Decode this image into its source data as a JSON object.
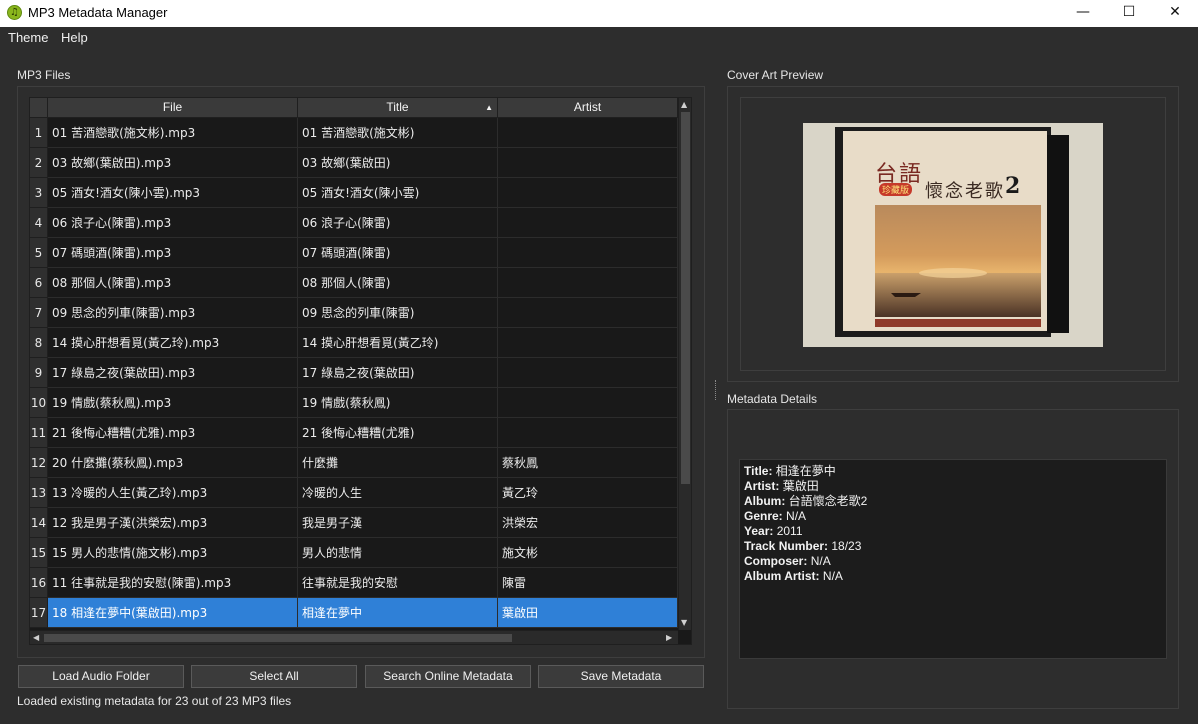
{
  "window": {
    "title": "MP3 Metadata Manager",
    "controls": {
      "minimize": "—",
      "maximize": "☐",
      "close": "✕"
    }
  },
  "menu": {
    "items": [
      "Theme",
      "Help"
    ]
  },
  "files_panel": {
    "label": "MP3 Files",
    "columns": [
      "File",
      "Title",
      "Artist"
    ],
    "sort_column": "Title",
    "rows": [
      {
        "n": "1",
        "file": "01 苦酒戀歌(施文彬).mp3",
        "title": "01 苦酒戀歌(施文彬)",
        "artist": ""
      },
      {
        "n": "2",
        "file": "03 故鄉(葉啟田).mp3",
        "title": "03 故鄉(葉啟田)",
        "artist": ""
      },
      {
        "n": "3",
        "file": "05 酒女!酒女(陳小雲).mp3",
        "title": "05 酒女!酒女(陳小雲)",
        "artist": ""
      },
      {
        "n": "4",
        "file": "06 浪子心(陳雷).mp3",
        "title": "06 浪子心(陳雷)",
        "artist": ""
      },
      {
        "n": "5",
        "file": "07 碼頭酒(陳雷).mp3",
        "title": "07 碼頭酒(陳雷)",
        "artist": ""
      },
      {
        "n": "6",
        "file": "08 那個人(陳雷).mp3",
        "title": "08 那個人(陳雷)",
        "artist": ""
      },
      {
        "n": "7",
        "file": "09 思念的列車(陳雷).mp3",
        "title": "09 思念的列車(陳雷)",
        "artist": ""
      },
      {
        "n": "8",
        "file": "14 摸心肝想看覓(黃乙玲).mp3",
        "title": "14 摸心肝想看覓(黃乙玲)",
        "artist": ""
      },
      {
        "n": "9",
        "file": "17 綠島之夜(葉啟田).mp3",
        "title": "17 綠島之夜(葉啟田)",
        "artist": ""
      },
      {
        "n": "10",
        "file": "19 情戲(蔡秋鳳).mp3",
        "title": "19 情戲(蔡秋鳳)",
        "artist": ""
      },
      {
        "n": "11",
        "file": "21 後悔心糟糟(尤雅).mp3",
        "title": "21 後悔心糟糟(尤雅)",
        "artist": ""
      },
      {
        "n": "12",
        "file": "20 什麼攤(蔡秋鳳).mp3",
        "title": "什麼攤",
        "artist": "蔡秋鳳"
      },
      {
        "n": "13",
        "file": "13 冷暖的人生(黃乙玲).mp3",
        "title": "冷暖的人生",
        "artist": "黃乙玲"
      },
      {
        "n": "14",
        "file": "12 我是男子漢(洪榮宏).mp3",
        "title": "我是男子漢",
        "artist": "洪榮宏"
      },
      {
        "n": "15",
        "file": "15 男人的悲情(施文彬).mp3",
        "title": "男人的悲情",
        "artist": "施文彬"
      },
      {
        "n": "16",
        "file": "11 往事就是我的安慰(陳雷).mp3",
        "title": "往事就是我的安慰",
        "artist": "陳雷"
      },
      {
        "n": "17",
        "file": "18 相逢在夢中(葉啟田).mp3",
        "title": "相逢在夢中",
        "artist": "葉啟田",
        "selected": true
      }
    ]
  },
  "buttons": {
    "load": "Load Audio Folder",
    "select_all": "Select All",
    "search": "Search Online Metadata",
    "save": "Save Metadata"
  },
  "status": "Loaded existing metadata for 23 out of 23 MP3 files",
  "cover_panel": {
    "label": "Cover Art Preview",
    "cover_title_1": "台語",
    "cover_title_2": "懷念老歌",
    "cover_number": "2",
    "cover_tag": "珍藏版"
  },
  "metadata_panel": {
    "label": "Metadata Details",
    "fields": [
      {
        "key": "Title:",
        "value": "相逢在夢中"
      },
      {
        "key": "Artist:",
        "value": "葉啟田"
      },
      {
        "key": "Album:",
        "value": "台語懷念老歌2"
      },
      {
        "key": "Genre:",
        "value": "N/A"
      },
      {
        "key": "Year:",
        "value": "2011"
      },
      {
        "key": "Track Number:",
        "value": "18/23"
      },
      {
        "key": "Composer:",
        "value": "N/A"
      },
      {
        "key": "Album Artist:",
        "value": "N/A"
      }
    ]
  },
  "colors": {
    "selection": "#2f80d7",
    "background": "#2d2d2d",
    "table_bg": "#191919"
  }
}
